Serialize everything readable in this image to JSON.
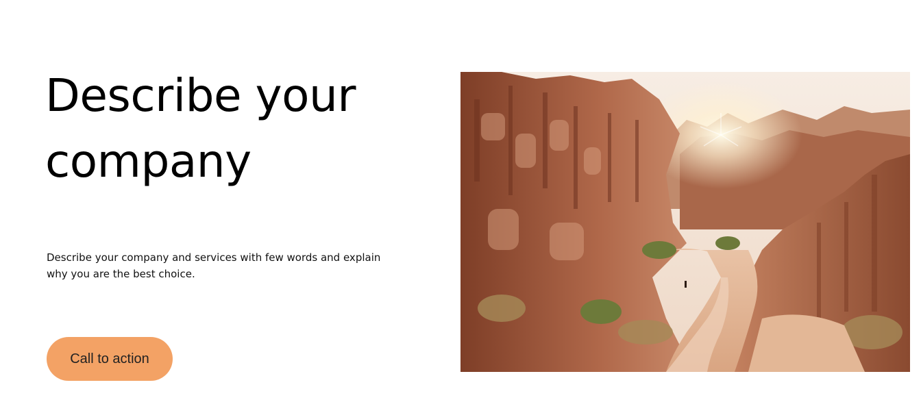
{
  "hero": {
    "title_line1": "Describe your",
    "title_line2": "company",
    "description": "Describe your company and services with few words and explain why you are the best choice.",
    "cta_label": "Call to action"
  },
  "colors": {
    "background": "#ffffff",
    "cta_background": "#f3a265",
    "text": "#000000"
  }
}
